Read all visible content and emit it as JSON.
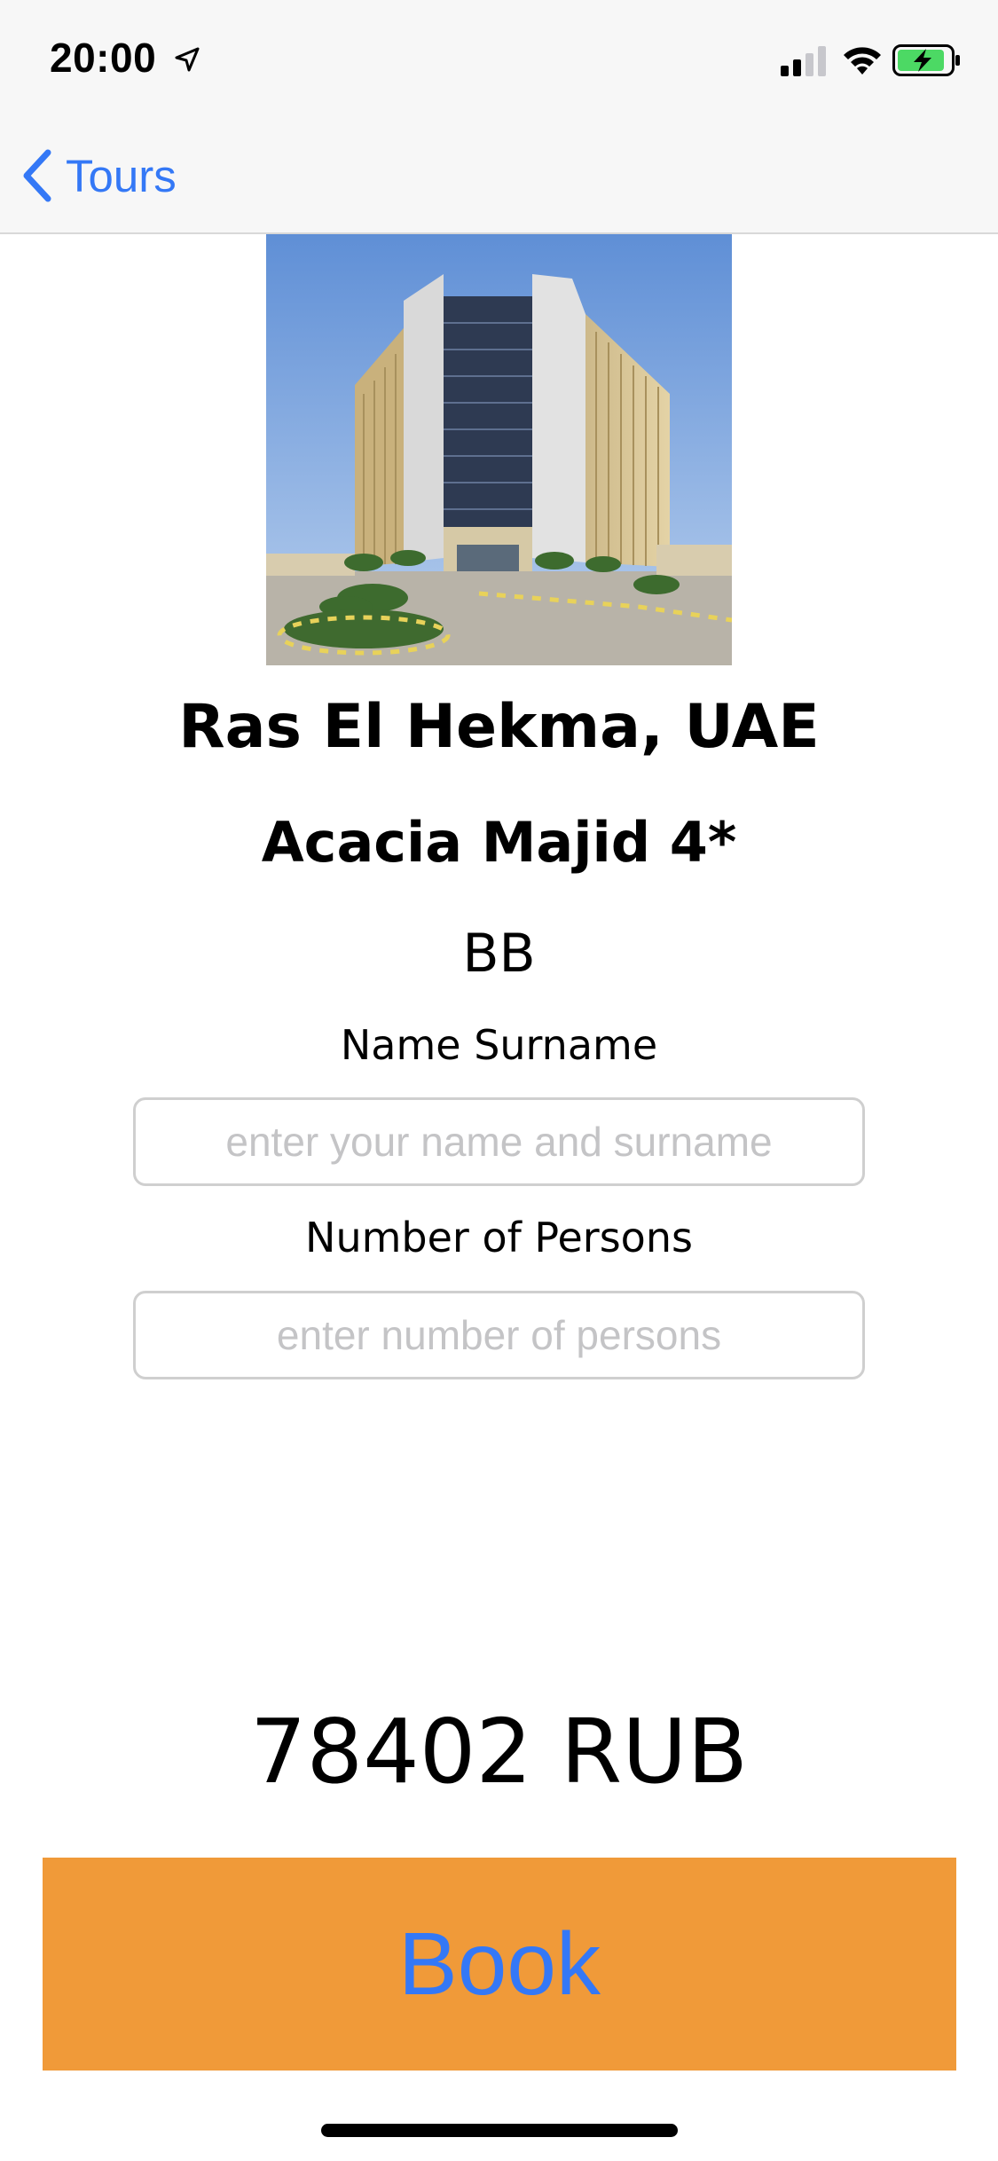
{
  "status_bar": {
    "time": "20:00",
    "icons": [
      "location-arrow-icon",
      "cellular-signal-icon",
      "wifi-icon",
      "battery-charging-icon"
    ]
  },
  "nav": {
    "back_label": "Tours",
    "accent_color": "#3478f6"
  },
  "tour": {
    "location": "Ras El Hekma, UAE",
    "hotel_name": "Acacia Majid 4*",
    "meal_plan": "BB"
  },
  "form": {
    "name": {
      "label": "Name Surname",
      "value": "",
      "placeholder": "enter your name and surname"
    },
    "persons": {
      "label": "Number of Persons",
      "value": "",
      "placeholder": "enter number of persons"
    }
  },
  "price": "78402 RUB",
  "book_button": {
    "label": "Book",
    "background_color": "#f09a39"
  }
}
